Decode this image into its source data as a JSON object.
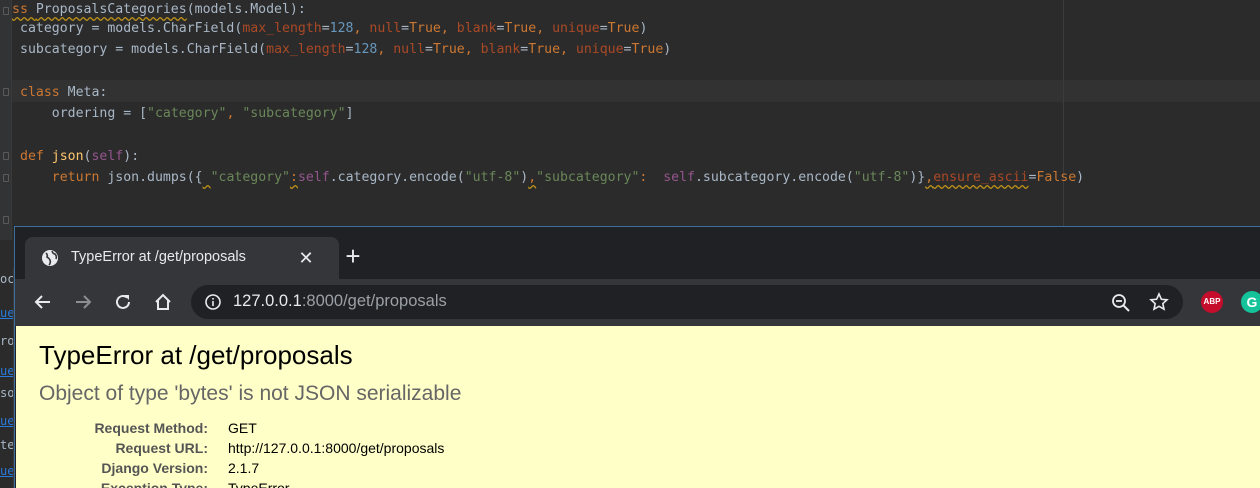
{
  "editor": {
    "line1": {
      "kw": "ss ",
      "name": "ProposalsCategories",
      "rest": "(models.Model):"
    },
    "line2": {
      "a": "category = models.CharField(",
      "p1": "max_length",
      "eq1": "=",
      "n1": "128",
      "c1": ", ",
      "p2": "null",
      "eq2": "=",
      "k2": "True",
      "c2": ", ",
      "p3": "blank",
      "eq3": "=",
      "k3": "True",
      "c3": ", ",
      "p4": "unique",
      "eq4": "=",
      "k4": "True",
      "end": ")"
    },
    "line3": {
      "a": "subcategory = models.CharField(",
      "p1": "max_length",
      "eq1": "=",
      "n1": "128",
      "c1": ", ",
      "p2": "null",
      "eq2": "=",
      "k2": "True",
      "c2": ", ",
      "p3": "blank",
      "eq3": "=",
      "k3": "True",
      "c3": ", ",
      "p4": "unique",
      "eq4": "=",
      "k4": "True",
      "end": ")"
    },
    "line4": {
      "kw": "class ",
      "rest": "Meta:"
    },
    "line5": {
      "a": "    ordering = [",
      "s1": "\"category\"",
      "c": ", ",
      "s2": "\"subcategory\"",
      "end": "]"
    },
    "line6": {
      "kw": "def ",
      "fn": "json",
      "o": "(",
      "slf": "self",
      "end": "):"
    },
    "line7": {
      "indent": "    ",
      "kw": "return ",
      "a": "json.dumps({",
      "sp": " ",
      "s1": "\"category\"",
      "colon": ":",
      "slf1": "self",
      "b": ".category.encode(",
      "s2": "\"utf-8\"",
      "close1": ")",
      "comma": ",",
      "s3": "\"subcategory\"",
      "colon2": ":  ",
      "slf2": "self",
      "c": ".subcategory.encode(",
      "s4": "\"utf-8\"",
      "close2": ")}",
      "comma2": ",",
      "p": "ensure_ascii",
      "eq": "=",
      "k": "False",
      "end": ")"
    }
  },
  "left_strip": [
    "oca",
    "ue",
    "roo",
    "ue",
    "sou",
    "ue",
    "te",
    "ue"
  ],
  "browser": {
    "tab_title": "TypeError at /get/proposals",
    "tab_close": "✕",
    "new_tab": "+",
    "url_host": "127.0.0.1",
    "url_rest": ":8000/get/proposals",
    "ext_abp": "ABP",
    "ext_grammarly": "G"
  },
  "page": {
    "title": "TypeError at /get/proposals",
    "message": "Object of type 'bytes' is not JSON serializable",
    "meta": [
      {
        "key": "Request Method:",
        "value": "GET"
      },
      {
        "key": "Request URL:",
        "value": "http://127.0.0.1:8000/get/proposals"
      },
      {
        "key": "Django Version:",
        "value": "2.1.7"
      },
      {
        "key": "Exception Type:",
        "value": "TypeError"
      }
    ]
  },
  "colors": {
    "editor_bg": "#2b2b2b",
    "keyword": "#cc7832",
    "string": "#6a8759",
    "number": "#6897bb",
    "self": "#94558d",
    "browser_frame": "#202124",
    "toolbar": "#35363a",
    "error_bg": "#ffffc8"
  }
}
